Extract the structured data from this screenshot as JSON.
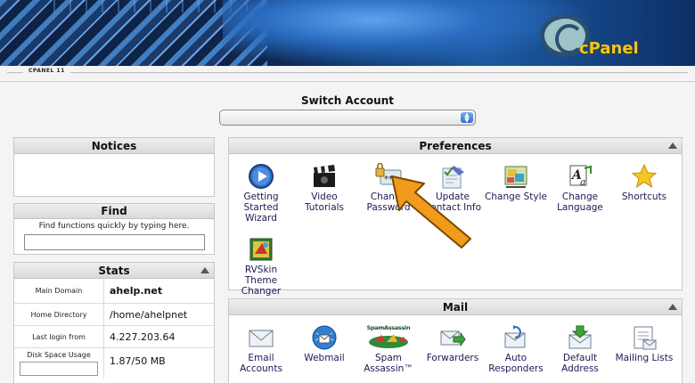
{
  "header": {
    "logo_text": "cPanel",
    "breadcrumb": "CPANEL 11"
  },
  "switch_account": {
    "label": "Switch Account",
    "value": ""
  },
  "notices": {
    "title": "Notices"
  },
  "find": {
    "title": "Find",
    "hint": "Find functions quickly by typing here.",
    "value": ""
  },
  "stats": {
    "title": "Stats",
    "rows": [
      {
        "label": "Main Domain",
        "value": "ahelp.net"
      },
      {
        "label": "Home Directory",
        "value": "/home/ahelpnet"
      },
      {
        "label": "Last login from",
        "value": "4.227.203.64"
      },
      {
        "label": "Disk Space Usage",
        "value": "1.87/50 MB"
      }
    ]
  },
  "preferences": {
    "title": "Preferences",
    "items": [
      {
        "label": "Getting Started Wizard",
        "icon": "play-circle-icon"
      },
      {
        "label": "Video Tutorials",
        "icon": "clapperboard-icon"
      },
      {
        "label": "Change Password",
        "icon": "lock-password-icon"
      },
      {
        "label": "Update Contact Info",
        "icon": "contact-card-icon"
      },
      {
        "label": "Change Style",
        "icon": "palette-icon"
      },
      {
        "label": "Change Language",
        "icon": "language-icon"
      },
      {
        "label": "Shortcuts",
        "icon": "star-icon"
      },
      {
        "label": "RVSkin Theme Changer",
        "icon": "theme-icon"
      }
    ]
  },
  "mail": {
    "title": "Mail",
    "items": [
      {
        "label": "Email Accounts",
        "icon": "envelope-icon"
      },
      {
        "label": "Webmail",
        "icon": "globe-mail-icon"
      },
      {
        "label": "Spam Assassin™",
        "icon": "spamassassin-icon",
        "logo_text": "SpamAssassin"
      },
      {
        "label": "Forwarders",
        "icon": "forward-mail-icon"
      },
      {
        "label": "Auto Responders",
        "icon": "auto-responder-icon"
      },
      {
        "label": "Default Address",
        "icon": "default-address-icon"
      },
      {
        "label": "Mailing Lists",
        "icon": "mailing-list-icon"
      }
    ]
  },
  "colors": {
    "accent": "#f29a1b",
    "link": "#1a1a55",
    "logo": "#f0c51a"
  }
}
